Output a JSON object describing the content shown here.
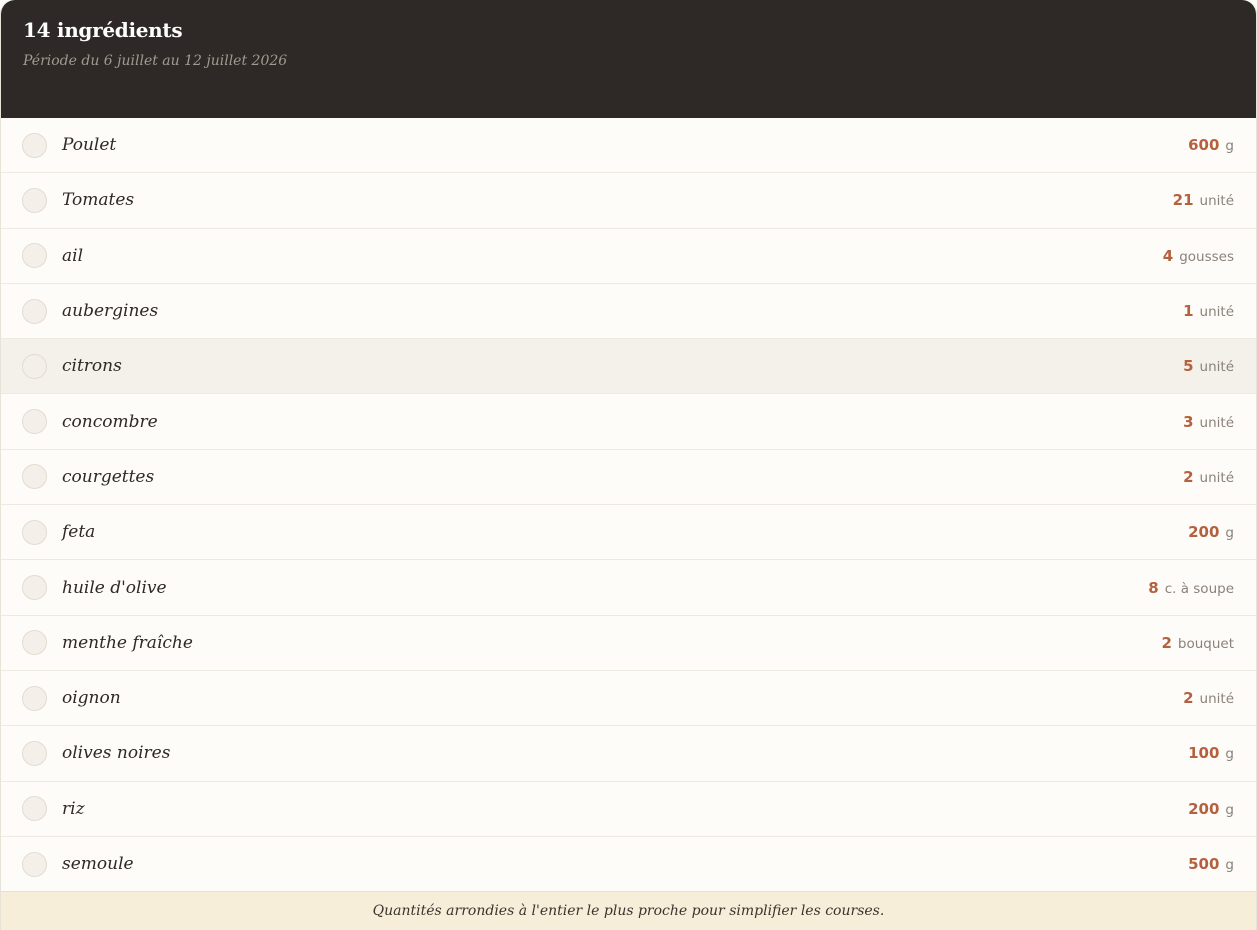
{
  "header": {
    "title": "14 ingrédients",
    "subtitle": "Période du 6 juillet au 12 juillet 2026"
  },
  "items": [
    {
      "name": "Poulet",
      "value": "600",
      "unit": "g",
      "highlighted": false
    },
    {
      "name": "Tomates",
      "value": "21",
      "unit": "unité",
      "highlighted": false
    },
    {
      "name": "ail",
      "value": "4",
      "unit": "gousses",
      "highlighted": false
    },
    {
      "name": "aubergines",
      "value": "1",
      "unit": "unité",
      "highlighted": false
    },
    {
      "name": "citrons",
      "value": "5",
      "unit": "unité",
      "highlighted": true
    },
    {
      "name": "concombre",
      "value": "3",
      "unit": "unité",
      "highlighted": false
    },
    {
      "name": "courgettes",
      "value": "2",
      "unit": "unité",
      "highlighted": false
    },
    {
      "name": "feta",
      "value": "200",
      "unit": "g",
      "highlighted": false
    },
    {
      "name": "huile d'olive",
      "value": "8",
      "unit": "c. à soupe",
      "highlighted": false
    },
    {
      "name": "menthe fraîche",
      "value": "2",
      "unit": "bouquet",
      "highlighted": false
    },
    {
      "name": "oignon",
      "value": "2",
      "unit": "unité",
      "highlighted": false
    },
    {
      "name": "olives noires",
      "value": "100",
      "unit": "g",
      "highlighted": false
    },
    {
      "name": "riz",
      "value": "200",
      "unit": "g",
      "highlighted": false
    },
    {
      "name": "semoule",
      "value": "500",
      "unit": "g",
      "highlighted": false
    }
  ],
  "footer": {
    "note": "Quantités arrondies à l'entier le plus proche pour simplifier les courses."
  },
  "colors": {
    "header_bg": "#2e2926",
    "accent": "#b5613f",
    "footer_bg": "#f6eed8",
    "row_highlight": "#f4f0ea"
  }
}
